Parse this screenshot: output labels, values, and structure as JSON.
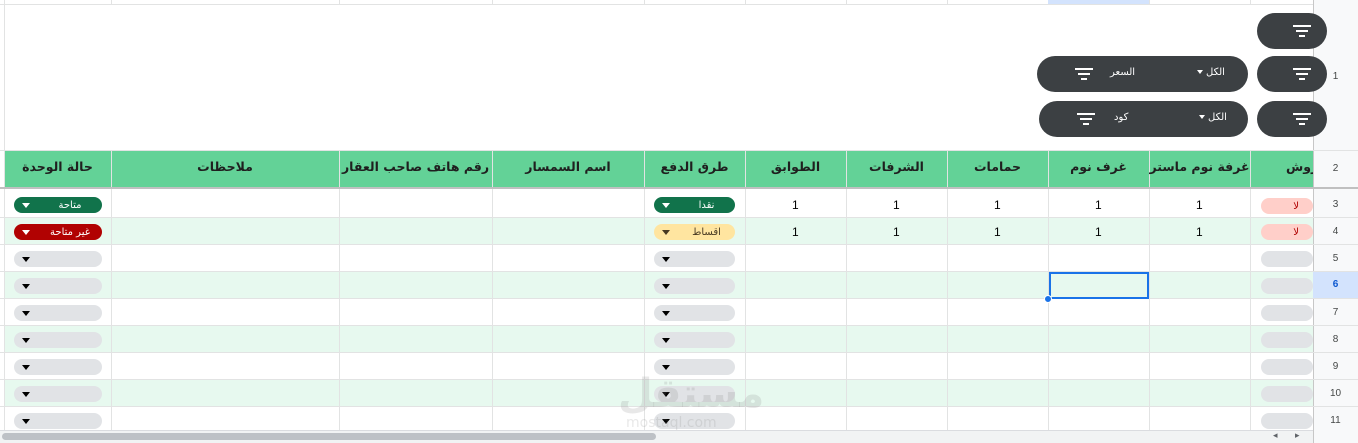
{
  "filters": [
    {
      "label": "السعر",
      "value": "الكل"
    },
    {
      "label": "كود",
      "value": "الكل"
    }
  ],
  "headers": [
    "فروش",
    "غرفة نوم ماستر",
    "غرف نوم",
    "حمامات",
    "الشرفات",
    "الطوابق",
    "طرق الدفع",
    "اسم السمسار",
    "رقم هاتف صاحب العقار",
    "ملاحظات",
    "حالة الوحدة"
  ],
  "row_numbers": [
    "1",
    "2",
    "3",
    "4",
    "5",
    "6",
    "7",
    "8",
    "9",
    "10",
    "11"
  ],
  "rows": [
    {
      "furnished": "لا",
      "master": "1",
      "bedrooms": "1",
      "bathrooms": "1",
      "balconies": "1",
      "floors": "1",
      "payment": "نقدا",
      "status": "متاحة"
    },
    {
      "furnished": "لا",
      "master": "1",
      "bedrooms": "1",
      "bathrooms": "1",
      "balconies": "1",
      "floors": "1",
      "payment": "اقساط",
      "status": "غير متاحة"
    }
  ],
  "colors": {
    "header_green": "#63d297",
    "band_green": "#e7f9ef",
    "cash_chip": "#11734b",
    "installment_chip": "#ffe5a0",
    "available_chip": "#11734b",
    "unavailable_chip": "#b10202",
    "furnished_no_chip": "#ffcfc9",
    "selection": "#1a73e8"
  },
  "watermark": {
    "text": "مستقل",
    "subtext": "mostaql.com"
  }
}
